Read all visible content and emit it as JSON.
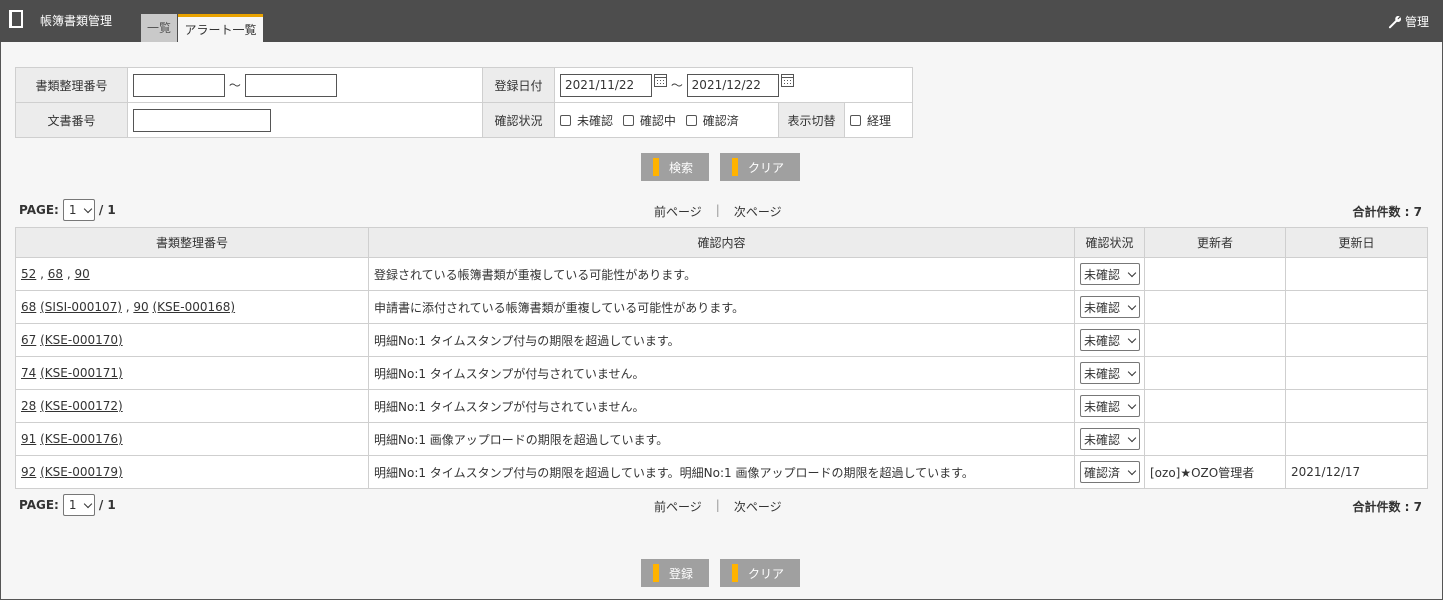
{
  "header": {
    "app_title": "帳簿書類管理",
    "tabs": [
      "一覧",
      "アラート一覧"
    ],
    "manage_label": "管理"
  },
  "search": {
    "doc_number_label": "書類整理番号",
    "range_sep": "～",
    "reg_date_label": "登録日付",
    "date_from": "2021/11/22",
    "date_to": "2021/12/22",
    "bunsho_label": "文書番号",
    "status_label": "確認状況",
    "status_options": [
      "未確認",
      "確認中",
      "確認済"
    ],
    "display_label": "表示切替",
    "display_option": "経理",
    "search_button": "検索",
    "clear_button": "クリア"
  },
  "pager": {
    "label": "PAGE:",
    "page": "1",
    "total_pages": "/ 1",
    "prev": "前ページ",
    "sep": "|",
    "next": "次ページ",
    "total": "合計件数 : 7"
  },
  "table": {
    "headers": [
      "書類整理番号",
      "確認内容",
      "確認状況",
      "更新者",
      "更新日"
    ],
    "rows": [
      {
        "links": [
          "52",
          "68",
          "90"
        ],
        "seps": [
          " , ",
          " , "
        ],
        "content": "登録されている帳簿書類が重複している可能性があります。",
        "status": "未確認",
        "updater": "",
        "date": ""
      },
      {
        "links": [
          "68",
          "(SISI-000107)",
          "90",
          "(KSE-000168)"
        ],
        "seps": [
          " ",
          " , ",
          " "
        ],
        "content": "申請書に添付されている帳簿書類が重複している可能性があります。",
        "status": "未確認",
        "updater": "",
        "date": ""
      },
      {
        "links": [
          "67",
          "(KSE-000170)"
        ],
        "seps": [
          " "
        ],
        "content": "明細No:1 タイムスタンプ付与の期限を超過しています。",
        "status": "未確認",
        "updater": "",
        "date": ""
      },
      {
        "links": [
          "74",
          "(KSE-000171)"
        ],
        "seps": [
          " "
        ],
        "content": "明細No:1 タイムスタンプが付与されていません。",
        "status": "未確認",
        "updater": "",
        "date": ""
      },
      {
        "links": [
          "28",
          "(KSE-000172)"
        ],
        "seps": [
          " "
        ],
        "content": "明細No:1 タイムスタンプが付与されていません。",
        "status": "未確認",
        "updater": "",
        "date": ""
      },
      {
        "links": [
          "91",
          "(KSE-000176)"
        ],
        "seps": [
          " "
        ],
        "content": "明細No:1 画像アップロードの期限を超過しています。",
        "status": "未確認",
        "updater": "",
        "date": ""
      },
      {
        "links": [
          "92",
          "(KSE-000179)"
        ],
        "seps": [
          " "
        ],
        "content": "明細No:1 タイムスタンプ付与の期限を超過しています。明細No:1 画像アップロードの期限を超過しています。",
        "status": "確認済",
        "updater": "[ozo]★OZO管理者",
        "date": "2021/12/17"
      }
    ]
  },
  "footer": {
    "register_button": "登録",
    "clear_button": "クリア"
  }
}
